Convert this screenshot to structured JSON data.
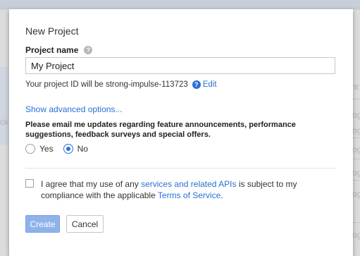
{
  "background": {
    "fragments": [
      "nt",
      "ck",
      "og",
      "og",
      "og",
      "og",
      "og",
      "og"
    ]
  },
  "dialog": {
    "title": "New Project",
    "project_name_label": "Project name",
    "project_name_value": "My Project",
    "project_id_text": "Your project ID will be strong-impulse-113723",
    "edit_label": "Edit",
    "advanced_link": "Show advanced options...",
    "email_question": "Please email me updates regarding feature announcements, performance suggestions, feedback surveys and special offers.",
    "radio_yes": "Yes",
    "radio_no": "No",
    "selected_radio": "No",
    "agree_prefix": "I agree that my use of any ",
    "agree_link_apis": "services and related APIs",
    "agree_middle": " is subject to my compliance with the applicable ",
    "agree_link_terms": "Terms of Service",
    "agree_suffix": ".",
    "create_button": "Create",
    "cancel_button": "Cancel",
    "help_glyph": "?"
  },
  "colors": {
    "accent": "#2a6fd6",
    "create_disabled": "#8fb2ea"
  },
  "icons": [
    "help-circle-icon"
  ]
}
